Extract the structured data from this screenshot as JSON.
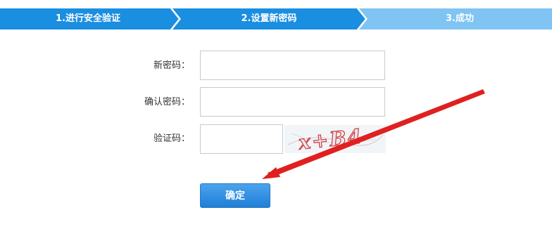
{
  "steps": [
    {
      "label": "1.进行安全验证",
      "color": "#1a8ee0"
    },
    {
      "label": "2.设置新密码",
      "color": "#1a8ee0"
    },
    {
      "label": "3.成功",
      "color": "#7fc4f3"
    }
  ],
  "form": {
    "new_password_label": "新密码：",
    "new_password_value": "",
    "confirm_password_label": "确认密码：",
    "confirm_password_value": "",
    "captcha_label": "验证码：",
    "captcha_value": "",
    "captcha_image_text": "x+B4",
    "submit_label": "确定"
  },
  "colors": {
    "accent": "#1a8ee0",
    "accent_light": "#7fc4f3",
    "annotation_arrow": "#e02020"
  }
}
